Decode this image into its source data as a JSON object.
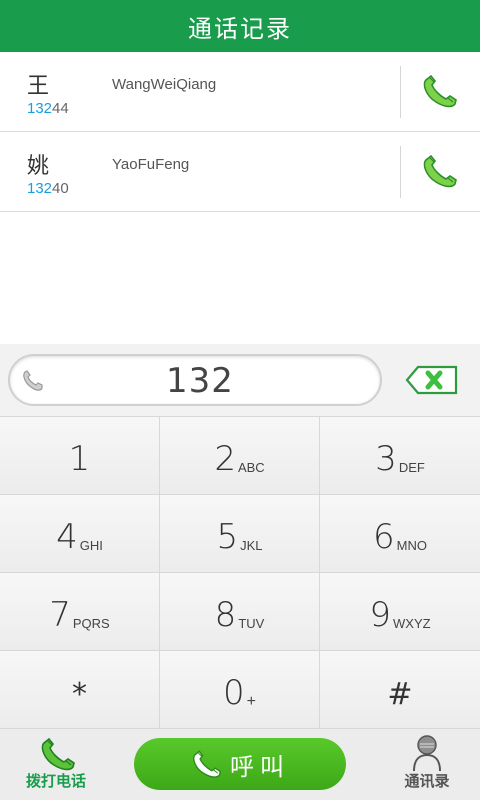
{
  "header": {
    "title": "通话记录"
  },
  "calls": [
    {
      "name": "王",
      "pinyin": "WangWeiQiang",
      "number_match": "132",
      "number_rest": "44"
    },
    {
      "name": "姚",
      "pinyin": "YaoFuFeng",
      "number_match": "132",
      "number_rest": "40"
    }
  ],
  "dialer": {
    "input_value": "132"
  },
  "keys": [
    {
      "digit": "1",
      "letters": ""
    },
    {
      "digit": "2",
      "letters": "ABC"
    },
    {
      "digit": "3",
      "letters": "DEF"
    },
    {
      "digit": "4",
      "letters": "GHI"
    },
    {
      "digit": "5",
      "letters": "JKL"
    },
    {
      "digit": "6",
      "letters": "MNO"
    },
    {
      "digit": "7",
      "letters": "PQRS"
    },
    {
      "digit": "8",
      "letters": "TUV"
    },
    {
      "digit": "9",
      "letters": "WXYZ"
    },
    {
      "digit": "*",
      "letters": ""
    },
    {
      "digit": "0",
      "letters": "+"
    },
    {
      "digit": "#",
      "letters": ""
    }
  ],
  "bottom": {
    "dial_tab_label": "拨打电话",
    "call_label": "呼叫",
    "contacts_tab_label": "通讯录"
  },
  "colors": {
    "brand_green": "#1a9c4d",
    "call_green": "#4ab520",
    "match_blue": "#1e9cd9"
  }
}
